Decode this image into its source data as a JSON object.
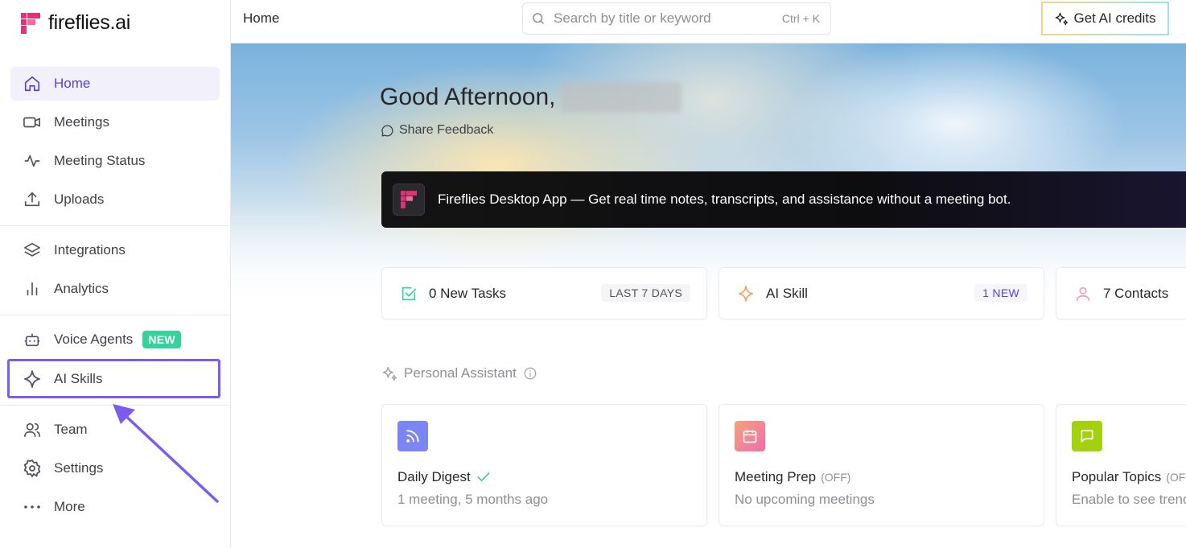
{
  "brand": {
    "name": "fireflies.ai",
    "accent": "#7c5cf0",
    "logo_pink": "#e5317a"
  },
  "sidebar": {
    "items": [
      {
        "label": "Home",
        "icon": "home-icon"
      },
      {
        "label": "Meetings",
        "icon": "video-icon"
      },
      {
        "label": "Meeting Status",
        "icon": "activity-icon"
      },
      {
        "label": "Uploads",
        "icon": "upload-icon"
      },
      {
        "label": "Integrations",
        "icon": "layers-icon"
      },
      {
        "label": "Analytics",
        "icon": "bar-chart-icon"
      },
      {
        "label": "Voice Agents",
        "icon": "bot-icon",
        "badge": "NEW"
      },
      {
        "label": "AI Skills",
        "icon": "sparkle-icon"
      },
      {
        "label": "Team",
        "icon": "users-icon"
      },
      {
        "label": "Settings",
        "icon": "gear-icon"
      },
      {
        "label": "More",
        "icon": "more-dots-icon"
      }
    ]
  },
  "header": {
    "breadcrumb": "Home",
    "search_placeholder": "Search by title or keyword",
    "search_shortcut": "Ctrl + K",
    "credits_label": "Get AI credits"
  },
  "hero": {
    "greeting": "Good Afternoon,",
    "feedback_label": "Share Feedback"
  },
  "banner": {
    "text": "Fireflies Desktop App — Get real time notes, transcripts, and assistance without a meeting bot."
  },
  "stats": [
    {
      "label": "0 New Tasks",
      "tag": "LAST 7 DAYS",
      "icon": "check-square-icon"
    },
    {
      "label": "AI Skill",
      "tag": "1 NEW",
      "icon": "sparkle-icon"
    },
    {
      "label": "7 Contacts",
      "icon": "user-icon"
    }
  ],
  "personal_assistant": {
    "title": "Personal Assistant",
    "cards": [
      {
        "name": "Daily Digest",
        "subtitle": "1 meeting, 5 months ago",
        "icon": "rss-icon",
        "color": "#7b86f2"
      },
      {
        "name": "Meeting Prep",
        "status": "(OFF)",
        "subtitle": "No upcoming meetings",
        "icon": "calendar-icon",
        "color": "#f07aa0"
      },
      {
        "name": "Popular Topics",
        "status": "(OFF)",
        "subtitle": "Enable to see trends",
        "icon": "chat-icon",
        "color": "#a3d10d"
      }
    ]
  }
}
